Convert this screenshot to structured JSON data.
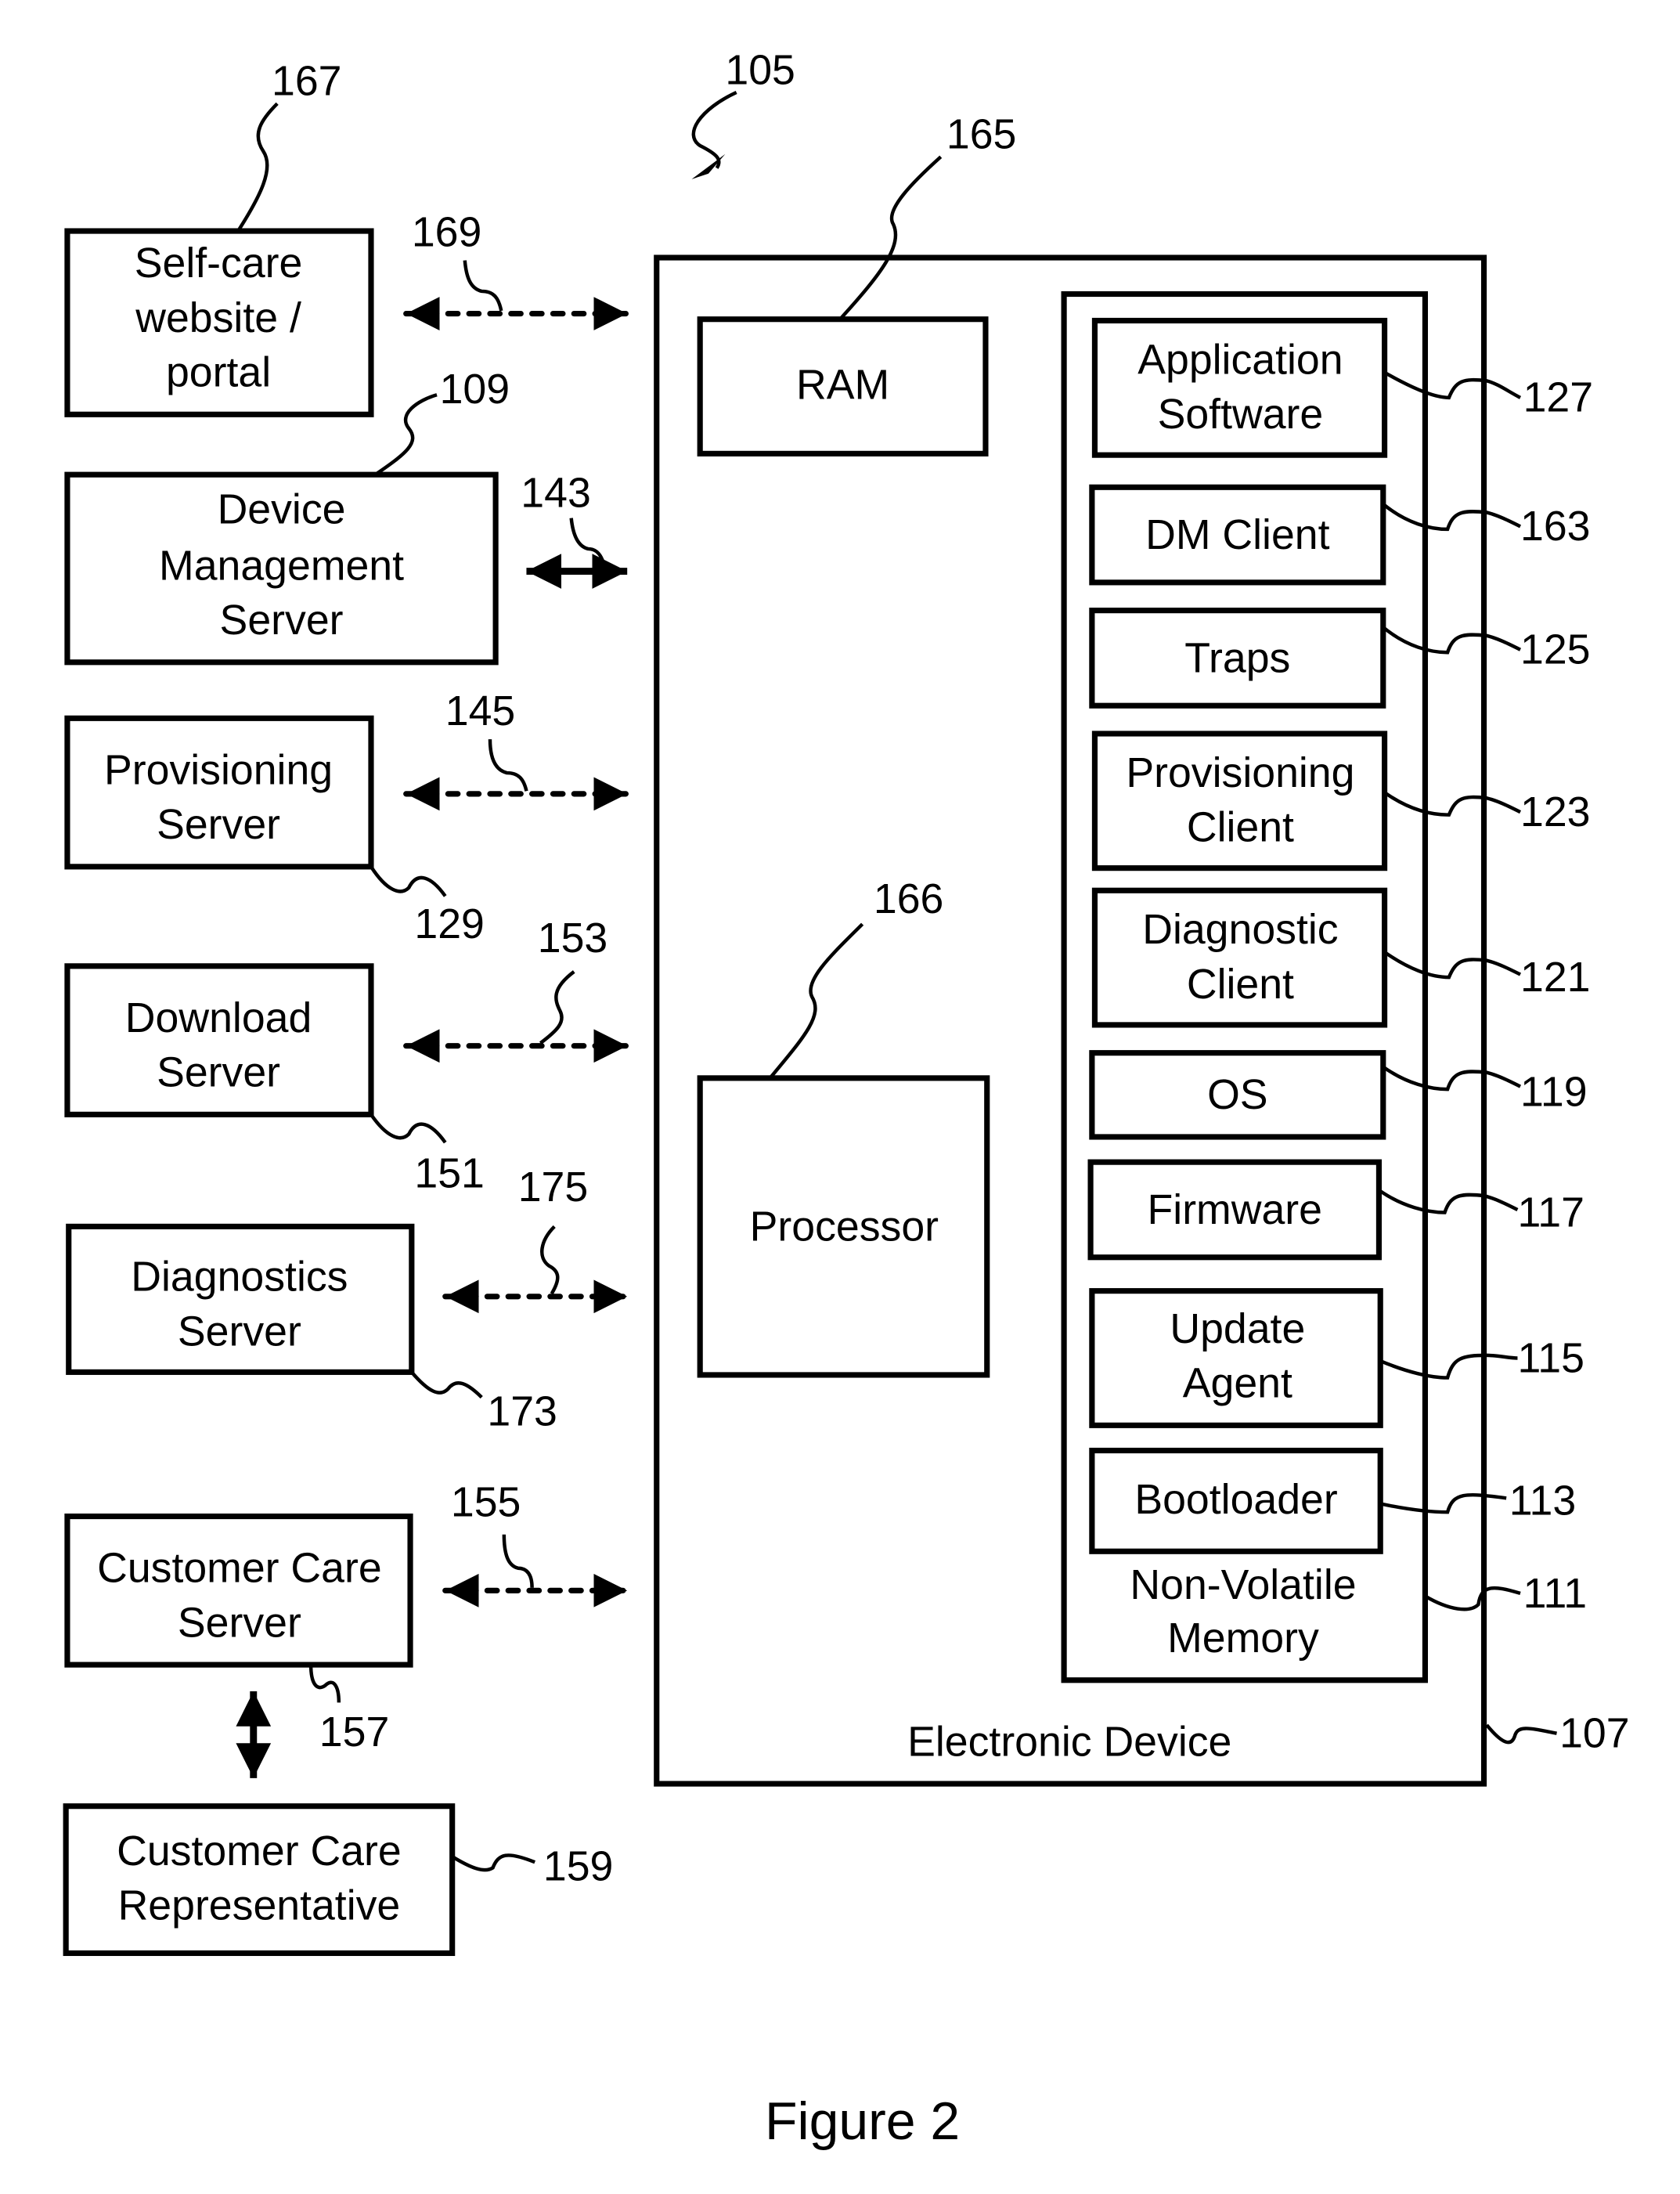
{
  "figure": {
    "caption": "Figure 2",
    "system_ref": "105"
  },
  "device": {
    "label": "Electronic Device",
    "ref": "107",
    "ram": {
      "label": "RAM",
      "ref": "165"
    },
    "processor": {
      "label": "Processor",
      "ref": "166"
    },
    "nvm": {
      "label_line1": "Non-Volatile",
      "label_line2": "Memory",
      "ref": "111",
      "components": [
        {
          "line1": "Application",
          "line2": "Software",
          "ref": "127"
        },
        {
          "line1": "DM Client",
          "line2": "",
          "ref": "163"
        },
        {
          "line1": "Traps",
          "line2": "",
          "ref": "125"
        },
        {
          "line1": "Provisioning",
          "line2": "Client",
          "ref": "123"
        },
        {
          "line1": "Diagnostic",
          "line2": "Client",
          "ref": "121"
        },
        {
          "line1": "OS",
          "line2": "",
          "ref": "119"
        },
        {
          "line1": "Firmware",
          "line2": "",
          "ref": "117"
        },
        {
          "line1": "Update",
          "line2": "Agent",
          "ref": "115"
        },
        {
          "line1": "Bootloader",
          "line2": "",
          "ref": "113"
        }
      ]
    }
  },
  "servers": [
    {
      "lines": [
        "Self-care",
        "website /",
        "portal"
      ],
      "ref": "167",
      "link_ref": "169",
      "link_style": "dashed"
    },
    {
      "lines": [
        "Device",
        "Management",
        "Server"
      ],
      "ref": "109",
      "link_ref": "143",
      "link_style": "solid"
    },
    {
      "lines": [
        "Provisioning",
        "Server"
      ],
      "ref": "129",
      "link_ref": "145",
      "link_style": "dashed"
    },
    {
      "lines": [
        "Download",
        "Server"
      ],
      "ref": "151",
      "link_ref": "153",
      "link_style": "dashed"
    },
    {
      "lines": [
        "Diagnostics",
        "Server"
      ],
      "ref": "173",
      "link_ref": "175",
      "link_style": "dashed"
    },
    {
      "lines": [
        "Customer Care",
        "Server"
      ],
      "ref": "157",
      "link_ref": "155",
      "link_style": "dashed"
    }
  ],
  "representative": {
    "lines": [
      "Customer Care",
      "Representative"
    ],
    "ref": "159"
  }
}
